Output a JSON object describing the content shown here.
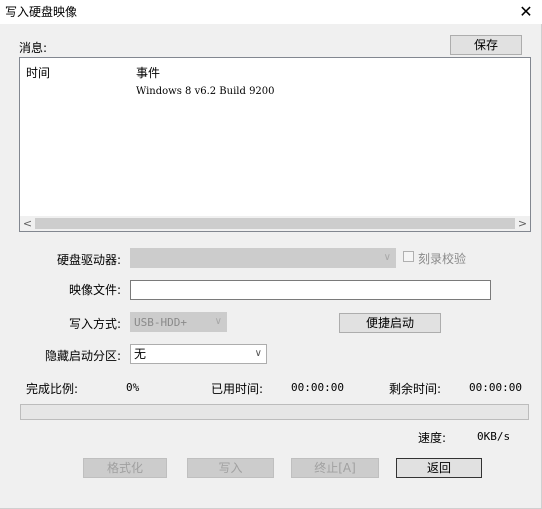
{
  "window": {
    "title": "写入硬盘映像"
  },
  "messages": {
    "label": "消息:",
    "save_button": "保存",
    "columns": [
      "时间",
      "事件"
    ],
    "rows": [
      {
        "time": "",
        "event": "Windows 8 v6.2 Build 9200"
      }
    ]
  },
  "form": {
    "drive_label": "硬盘驱动器:",
    "drive_value": "",
    "verify_label": "刻录校验",
    "image_label": "映像文件:",
    "image_value": "",
    "write_mode_label": "写入方式:",
    "write_mode_value": "USB-HDD+",
    "quick_boot_button": "便捷启动",
    "hidden_partition_label": "隐藏启动分区:",
    "hidden_partition_value": "无"
  },
  "status": {
    "complete_label": "完成比例:",
    "complete_value": "0%",
    "elapsed_label": "已用时间:",
    "elapsed_value": "00:00:00",
    "remaining_label": "剩余时间:",
    "remaining_value": "00:00:00",
    "progress": 0,
    "speed_label": "速度:",
    "speed_value": "0KB/s"
  },
  "buttons": {
    "format": "格式化",
    "write": "写入",
    "abort": "终止[A]",
    "back": "返回"
  },
  "icons": {
    "close": "close-icon",
    "dropdown": "chevron-down-icon",
    "scroll_left": "chevron-left-icon",
    "scroll_right": "chevron-right-icon"
  }
}
